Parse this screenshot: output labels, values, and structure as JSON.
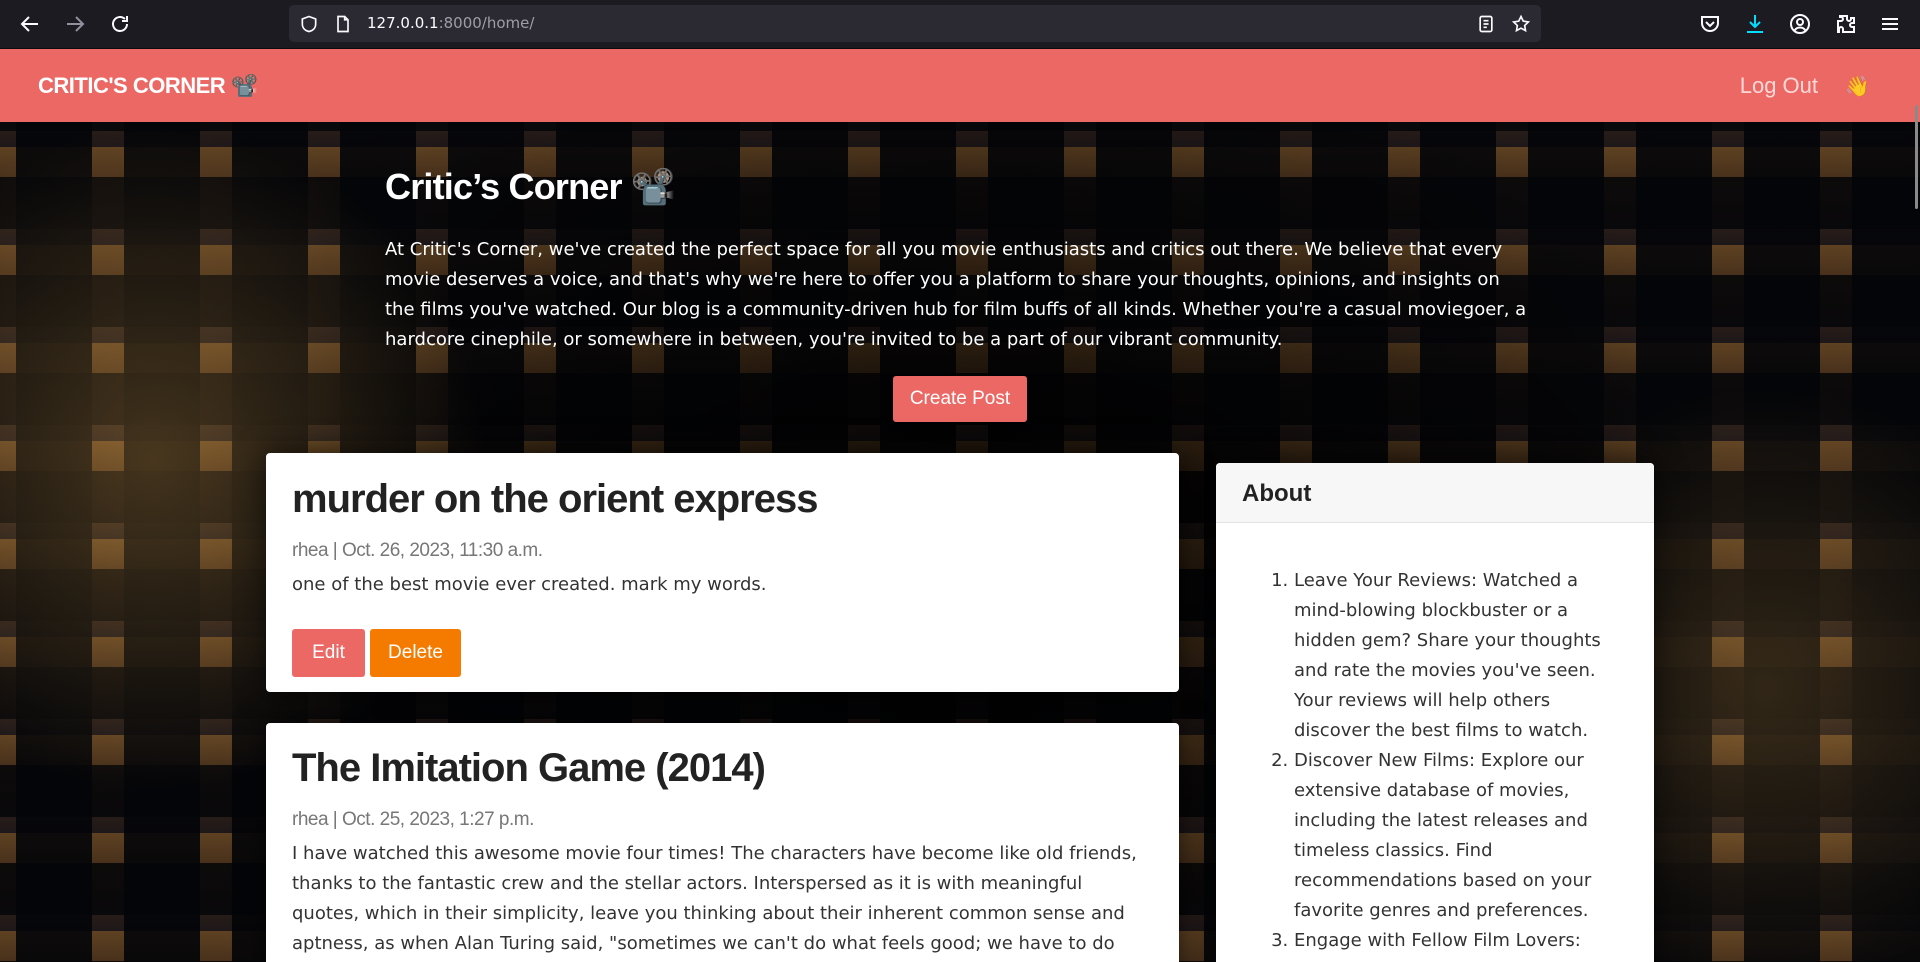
{
  "browser": {
    "url_host": "127.0.0.1",
    "url_rest": ":8000/home/",
    "icons": [
      "back-icon",
      "forward-icon",
      "reload-icon",
      "shield-icon",
      "page-info-icon",
      "reader-view-icon",
      "bookmark-star-icon",
      "pocket-icon",
      "download-icon",
      "account-icon",
      "extensions-icon",
      "menu-icon"
    ]
  },
  "navbar": {
    "brand": "CRITIC'S CORNER 📽️",
    "logout": "Log Out",
    "wave": "👋"
  },
  "masthead": {
    "title": "Critic’s Corner 📽️",
    "text": "At Critic's Corner, we've created the perfect space for all you movie enthusiasts and critics out there. We believe that every movie deserves a voice, and that's why we're here to offer you a platform to share your thoughts, opinions, and insights on the films you've watched. Our blog is a community-driven hub for film buffs of all kinds. Whether you're a casual moviegoer, a hardcore cinephile, or somewhere in between, you're invited to be a part of our vibrant community.",
    "create_post": "Create Post"
  },
  "posts": [
    {
      "title": "murder on the orient express",
      "meta": "rhea | Oct. 26, 2023, 11:30 a.m.",
      "body": "one of the best movie ever created. mark my words.",
      "edit": "Edit",
      "delete": "Delete"
    },
    {
      "title": "The Imitation Game (2014)",
      "meta": "rhea | Oct. 25, 2023, 1:27 p.m.",
      "body": "I have watched this awesome movie four times! The characters have become like old friends, thanks to the fantastic crew and the stellar actors. Interspersed as it is with meaningful quotes, which in their simplicity, leave you thinking about their inherent common sense and aptness, as when Alan Turing said, \"sometimes we can't do what feels good; we have to do what is logical.\""
    }
  ],
  "about": {
    "title": "About",
    "items": [
      "Leave Your Reviews: Watched a mind-blowing blockbuster or a hidden gem? Share your thoughts and rate the movies you've seen. Your reviews will help others discover the best films to watch.",
      "Discover New Films: Explore our extensive database of movies, including the latest releases and timeless classics. Find recommendations based on your favorite genres and preferences.",
      "Engage with Fellow Film Lovers:"
    ]
  }
}
